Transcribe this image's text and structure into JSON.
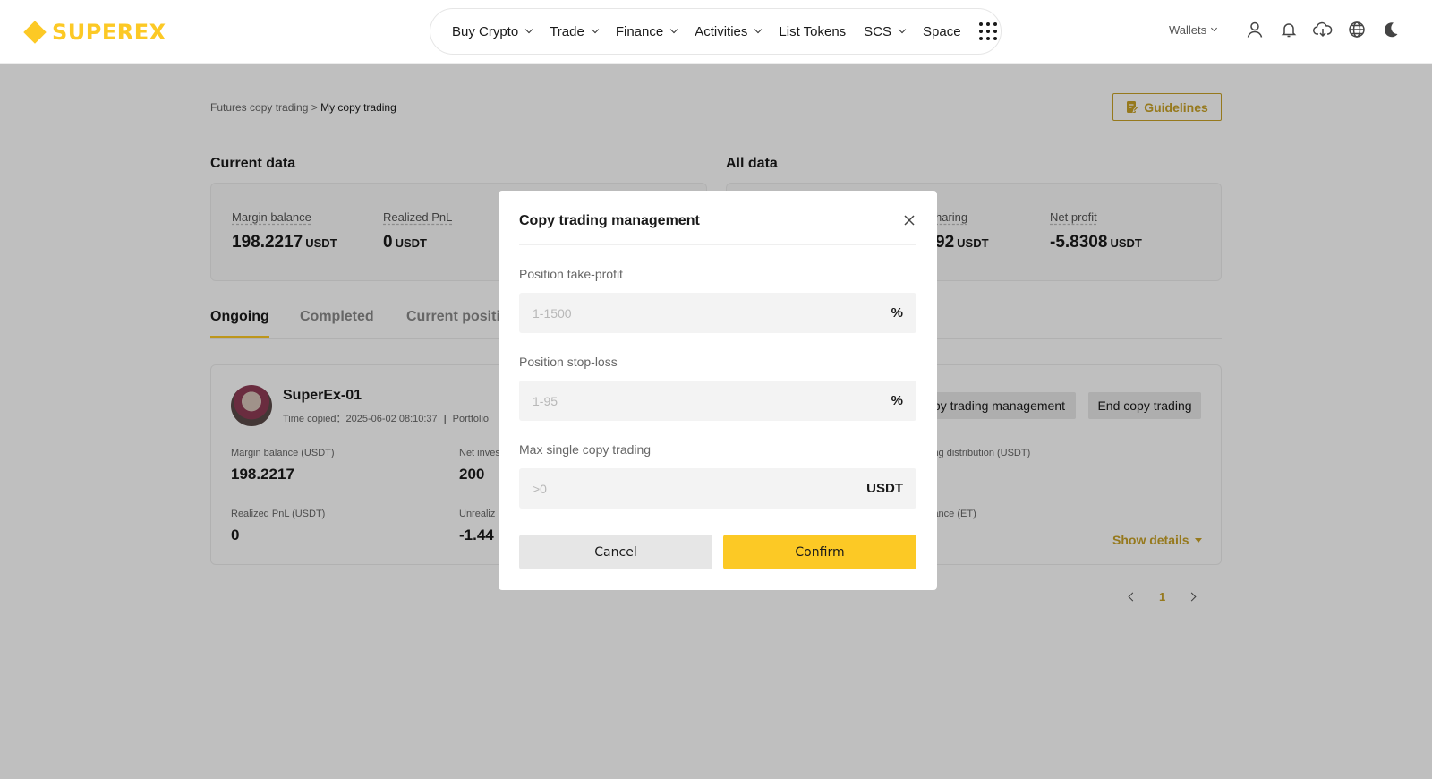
{
  "header": {
    "logo_text": "SUPEREX",
    "nav": [
      {
        "label": "Buy Crypto",
        "has_dropdown": true
      },
      {
        "label": "Trade",
        "has_dropdown": true
      },
      {
        "label": "Finance",
        "has_dropdown": true
      },
      {
        "label": "Activities",
        "has_dropdown": true
      },
      {
        "label": "List Tokens",
        "has_dropdown": false
      },
      {
        "label": "SCS",
        "has_dropdown": true
      },
      {
        "label": "Space",
        "has_dropdown": false
      }
    ],
    "wallets_label": "Wallets",
    "icons": [
      "user-icon",
      "bell-icon",
      "download-icon",
      "globe-icon",
      "moon-icon"
    ]
  },
  "breadcrumb": {
    "parent": "Futures copy trading",
    "separator": " > ",
    "current": "My copy trading"
  },
  "guidelines_label": "Guidelines",
  "current_data": {
    "title": "Current data",
    "margin_balance": {
      "label": "Margin balance",
      "value": "198.2217",
      "unit": "USDT"
    },
    "realized_pnl": {
      "label": "Realized PnL",
      "value": "0",
      "unit": "USDT"
    }
  },
  "all_data": {
    "title": "All data",
    "profit_sharing": {
      "label_partial": "haring",
      "value_partial": "92",
      "unit": "USDT"
    },
    "net_profit": {
      "label": "Net profit",
      "value": "-5.8308",
      "unit": "USDT"
    }
  },
  "tabs": [
    {
      "label": "Ongoing",
      "active": true
    },
    {
      "label": "Completed",
      "active": false
    },
    {
      "label": "Current positi",
      "active": false
    }
  ],
  "trader": {
    "name": "SuperEx-01",
    "time_copied_label": "Time copied：",
    "time_copied": "2025-06-02 08:10:37",
    "portfolio_partial": "Portfolio",
    "manage_partial": "py trading management",
    "end_label": "End copy trading",
    "margin_balance": {
      "label": "Margin balance (USDT)",
      "value": "198.2217"
    },
    "net_invest": {
      "label": "Net inves",
      "value": "200"
    },
    "distribution": {
      "label": "ing distribution (USDT)"
    },
    "realized_pnl": {
      "label": "Realized PnL (USDT)",
      "value": "0"
    },
    "unrealized": {
      "label": "Unrealiz",
      "value": "-1.44"
    },
    "balance_et": {
      "label": "lance (ET)"
    },
    "show_details": "Show details"
  },
  "pagination": {
    "current_page": "1"
  },
  "modal": {
    "title": "Copy trading management",
    "take_profit": {
      "label": "Position take-profit",
      "placeholder": "1-1500",
      "suffix": "%"
    },
    "stop_loss": {
      "label": "Position stop-loss",
      "placeholder": "1-95",
      "suffix": "%"
    },
    "max_single": {
      "label": "Max single copy trading",
      "placeholder": ">0",
      "suffix": "USDT"
    },
    "cancel": "Cancel",
    "confirm": "Confirm"
  },
  "colors": {
    "brand": "#fcc925",
    "accent_text": "#c9a227"
  }
}
